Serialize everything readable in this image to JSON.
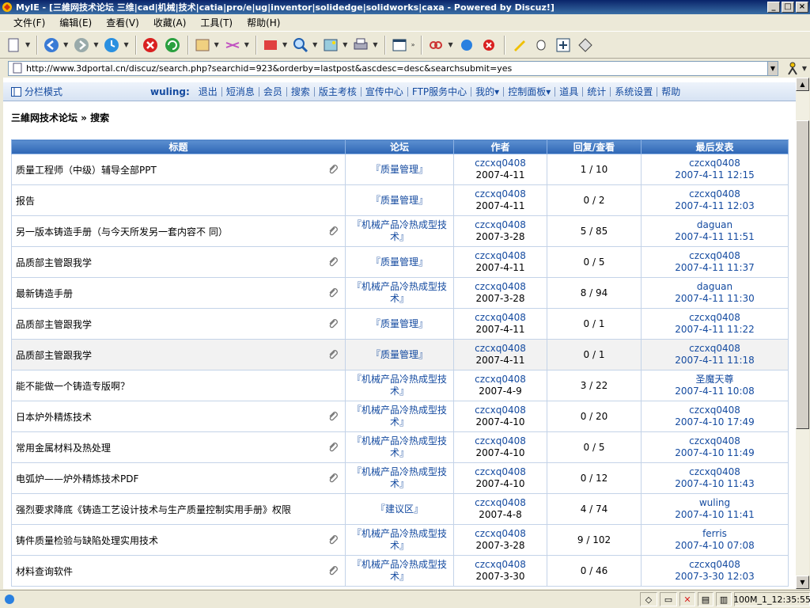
{
  "window": {
    "title": "MyIE - [三維网技术论坛 三维|cad|机械|技术|catia|pro/e|ug|inventor|solidedge|solidworks|caxa - Powered by Discuz!]"
  },
  "menu": [
    "文件(F)",
    "编辑(E)",
    "查看(V)",
    "收藏(A)",
    "工具(T)",
    "帮助(H)"
  ],
  "address": {
    "url": "http://www.3dportal.cn/discuz/search.php?searchid=923&orderby=lastpost&ascdesc=desc&searchsubmit=yes"
  },
  "nav": {
    "mode_label": "分栏模式",
    "username": "wuling:",
    "links": [
      "退出",
      "短消息",
      "会员",
      "搜索",
      "版主考核",
      "宣传中心",
      "FTP服务中心",
      "我的▾",
      "控制面板▾",
      "道具",
      "统计",
      "系统设置",
      "帮助"
    ]
  },
  "breadcrumb": "三維网技术论坛 » 搜索",
  "table": {
    "headers": [
      "标题",
      "论坛",
      "作者",
      "回复/查看",
      "最后发表"
    ],
    "rows": [
      {
        "subject": "质量工程师（中级）辅导全部PPT",
        "clip": true,
        "forum": "『质量管理』",
        "author": "czcxq0408",
        "date": "2007-4-11",
        "stats": "1 / 10",
        "last_user": "czcxq0408",
        "last_time": "2007-4-11 12:15"
      },
      {
        "subject": "报告",
        "clip": false,
        "forum": "『质量管理』",
        "author": "czcxq0408",
        "date": "2007-4-11",
        "stats": "0 / 2",
        "last_user": "czcxq0408",
        "last_time": "2007-4-11 12:03"
      },
      {
        "subject": "另一版本铸造手册（与今天所发另一套内容不 同）",
        "clip": true,
        "forum": "『机械产品冷热成型技术』",
        "author": "czcxq0408",
        "date": "2007-3-28",
        "stats": "5 / 85",
        "last_user": "daguan",
        "last_time": "2007-4-11 11:51"
      },
      {
        "subject": "品质部主管跟我学",
        "clip": true,
        "forum": "『质量管理』",
        "author": "czcxq0408",
        "date": "2007-4-11",
        "stats": "0 / 5",
        "last_user": "czcxq0408",
        "last_time": "2007-4-11 11:37"
      },
      {
        "subject": "最新铸造手册",
        "clip": true,
        "forum": "『机械产品冷热成型技术』",
        "author": "czcxq0408",
        "date": "2007-3-28",
        "stats": "8 / 94",
        "last_user": "daguan",
        "last_time": "2007-4-11 11:30"
      },
      {
        "subject": "品质部主管跟我学",
        "clip": true,
        "forum": "『质量管理』",
        "author": "czcxq0408",
        "date": "2007-4-11",
        "stats": "0 / 1",
        "last_user": "czcxq0408",
        "last_time": "2007-4-11 11:22"
      },
      {
        "subject": "品质部主管跟我学",
        "clip": true,
        "forum": "『质量管理』",
        "author": "czcxq0408",
        "date": "2007-4-11",
        "stats": "0 / 1",
        "last_user": "czcxq0408",
        "last_time": "2007-4-11 11:18"
      },
      {
        "subject": "能不能做一个铸造专版啊？",
        "clip": false,
        "forum": "『机械产品冷热成型技术』",
        "author": "czcxq0408",
        "date": "2007-4-9",
        "stats": "3 / 22",
        "last_user": "圣魔天尊",
        "last_time": "2007-4-11 10:08"
      },
      {
        "subject": "日本炉外精炼技术",
        "clip": true,
        "forum": "『机械产品冷热成型技术』",
        "author": "czcxq0408",
        "date": "2007-4-10",
        "stats": "0 / 20",
        "last_user": "czcxq0408",
        "last_time": "2007-4-10 17:49"
      },
      {
        "subject": "常用金属材料及热处理",
        "clip": true,
        "forum": "『机械产品冷热成型技术』",
        "author": "czcxq0408",
        "date": "2007-4-10",
        "stats": "0 / 5",
        "last_user": "czcxq0408",
        "last_time": "2007-4-10 11:49"
      },
      {
        "subject": "电弧炉——炉外精炼技术PDF",
        "clip": true,
        "forum": "『机械产品冷热成型技术』",
        "author": "czcxq0408",
        "date": "2007-4-10",
        "stats": "0 / 12",
        "last_user": "czcxq0408",
        "last_time": "2007-4-10 11:43"
      },
      {
        "subject": "强烈要求降底《铸造工艺设计技术与生产质量控制实用手册》权限",
        "clip": false,
        "forum": "『建议区』",
        "author": "czcxq0408",
        "date": "2007-4-8",
        "stats": "4 / 74",
        "last_user": "wuling",
        "last_time": "2007-4-10 11:41"
      },
      {
        "subject": "铸件质量检验与缺陷处理实用技术",
        "clip": true,
        "forum": "『机械产品冷热成型技术』",
        "author": "czcxq0408",
        "date": "2007-3-28",
        "stats": "9 / 102",
        "last_user": "ferris",
        "last_time": "2007-4-10 07:08"
      },
      {
        "subject": "材料查询软件",
        "clip": true,
        "forum": "『机械产品冷热成型技术』",
        "author": "czcxq0408",
        "date": "2007-3-30",
        "stats": "0 / 46",
        "last_user": "czcxq0408",
        "last_time": "2007-3-30 12:03"
      }
    ]
  },
  "status": {
    "zoom": "100M_1_12:35:55"
  },
  "colors": {
    "link": "#154ba0",
    "header": "#2e66b5"
  }
}
